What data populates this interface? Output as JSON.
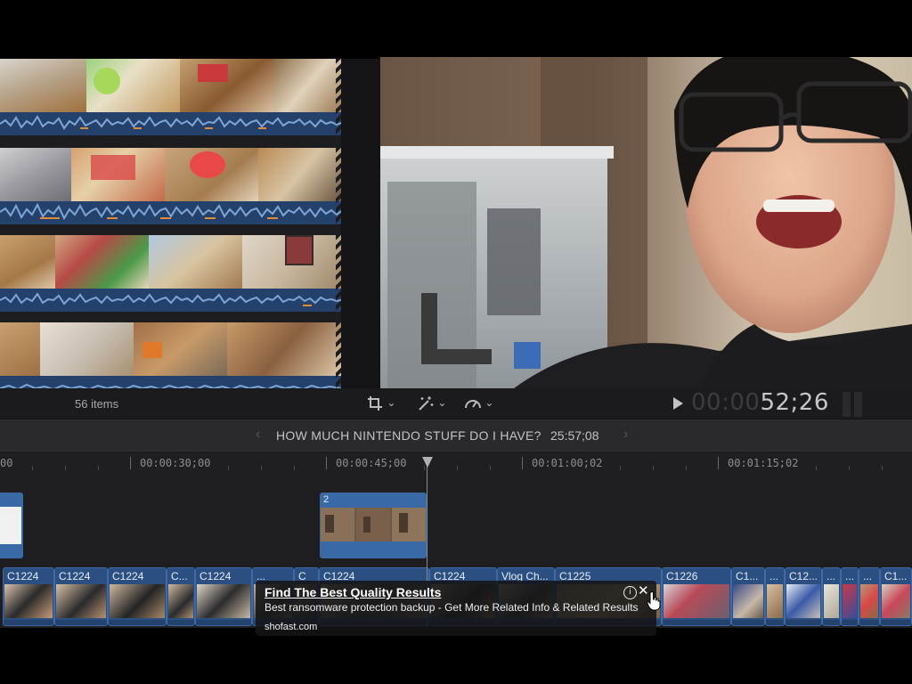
{
  "browser": {
    "items_count": "56 items"
  },
  "viewer": {
    "timecode_dim": "00:00",
    "timecode_bright": "52;26",
    "tools": {
      "crop_chevron": "⌄",
      "enhance_chevron": "⌄",
      "retime_chevron": "⌄"
    }
  },
  "project": {
    "title": "HOW MUCH NINTENDO STUFF DO I HAVE?",
    "duration": "25:57;08",
    "prev_arrow": "‹",
    "next_arrow": "›"
  },
  "ruler": {
    "labels": [
      "00",
      "00:00:30;00",
      "00:00:45;00",
      "00:01:00;02",
      "00:01:15;02"
    ]
  },
  "connected_clips": {
    "clip2_label": "2"
  },
  "storyline": {
    "clips": [
      "C1224",
      "C1224",
      "C1224",
      "C...",
      "C1224",
      "...",
      "C",
      "C1224",
      "C1224",
      "Vlog Ch...",
      "C1225",
      "C1226",
      "C1...",
      "...",
      "C12...",
      "...",
      "...",
      "...",
      "C1..."
    ]
  },
  "ad": {
    "title": "Find The Best Quality Results",
    "body": "Best ransomware protection backup - Get More Related Info & Related Results",
    "domain": "shofast.com",
    "info_icon": "i",
    "close_icon": "✕"
  }
}
